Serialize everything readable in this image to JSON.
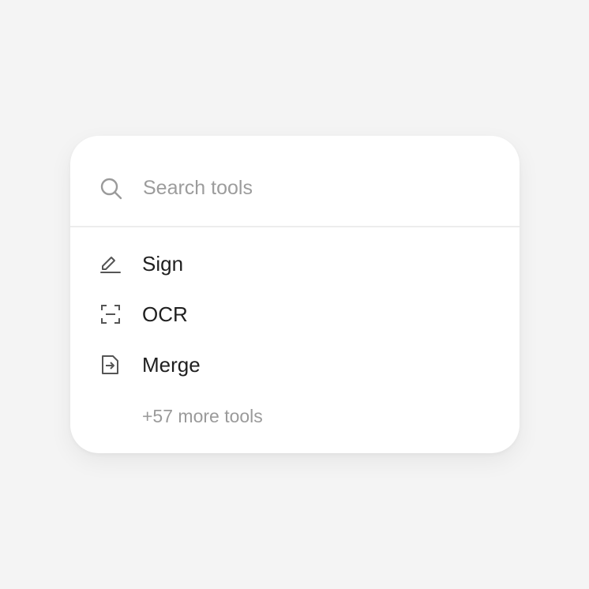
{
  "search": {
    "placeholder": "Search tools",
    "icon": "search-icon"
  },
  "tools": [
    {
      "label": "Sign",
      "icon": "pen-icon"
    },
    {
      "label": "OCR",
      "icon": "scan-icon"
    },
    {
      "label": "Merge",
      "icon": "file-import-icon"
    }
  ],
  "more": {
    "label": "+57 more tools"
  },
  "colors": {
    "background": "#f4f4f4",
    "card": "#ffffff",
    "text": "#1f1f1f",
    "muted": "#9a9a9a",
    "icon": "#555555"
  }
}
